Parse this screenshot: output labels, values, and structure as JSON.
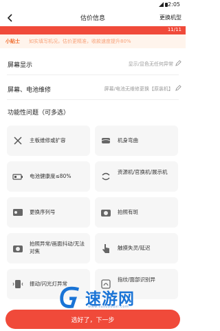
{
  "status": {
    "time": "2:05"
  },
  "header": {
    "title": "估价信息",
    "switch_label": "更换机型"
  },
  "progress": {
    "current": 11,
    "total": 11,
    "label": "11/11"
  },
  "tip": {
    "label": "小贴士",
    "text": "如实填写机况，估价更精准，收款速度提升80%"
  },
  "rows": [
    {
      "key": "屏幕显示",
      "value": "显示/显色无任何异常"
    },
    {
      "key": "屏幕、电池维修",
      "value": "屏幕/电池无维修更换【原装机】"
    }
  ],
  "section": {
    "title": "功能性问题（可多选）"
  },
  "options": [
    {
      "label": "主板维修或扩容",
      "icon": "tools-icon"
    },
    {
      "label": "机身弯曲",
      "icon": "bent-phone-icon"
    },
    {
      "label": "电池健康度≤80%",
      "icon": "battery-icon"
    },
    {
      "label": "资源机/官换机/展示机",
      "icon": "swap-icon"
    },
    {
      "label": "更换序列号",
      "icon": "id-card-icon"
    },
    {
      "label": "拍照有斑",
      "icon": "camera-icon"
    },
    {
      "label": "拍照异常/画面抖动/无法对焦",
      "icon": "camera-icon"
    },
    {
      "label": "触摸失灵/延迟",
      "icon": "touch-hand-icon"
    },
    {
      "label": "振动/闪光灯异常",
      "icon": "vibrate-icon"
    },
    {
      "label": "指纹/面部识别异",
      "icon": "fingerprint-icon"
    }
  ],
  "cta": {
    "label": "选好了，下一步"
  },
  "watermark": {
    "brand": "速游网",
    "url": "www.susuyouxi.com"
  },
  "colors": {
    "accent": "#f04a3a",
    "tip_bg": "#fff4ec",
    "card_bg": "#f6f6f6"
  }
}
